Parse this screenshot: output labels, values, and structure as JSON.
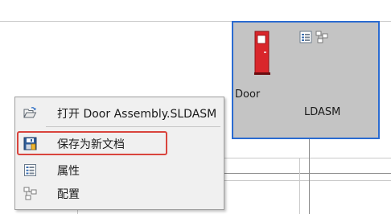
{
  "card": {
    "title_line1": "Door",
    "title_tail": "LDASM"
  },
  "context_menu": {
    "items": [
      {
        "label": "打开 Door Assembly.SLDASM",
        "icon": "open-folder-icon"
      },
      {
        "label": "保存为新文档",
        "icon": "save-new-document-icon"
      },
      {
        "label": "属性",
        "icon": "properties-icon"
      },
      {
        "label": "配置",
        "icon": "configuration-icon"
      }
    ]
  },
  "colors": {
    "card_border": "#2a6bd1",
    "card_background": "#c4c4c4",
    "menu_background": "#f0f0f0",
    "highlight_border": "#d9443d",
    "door_red": "#d9262b"
  }
}
